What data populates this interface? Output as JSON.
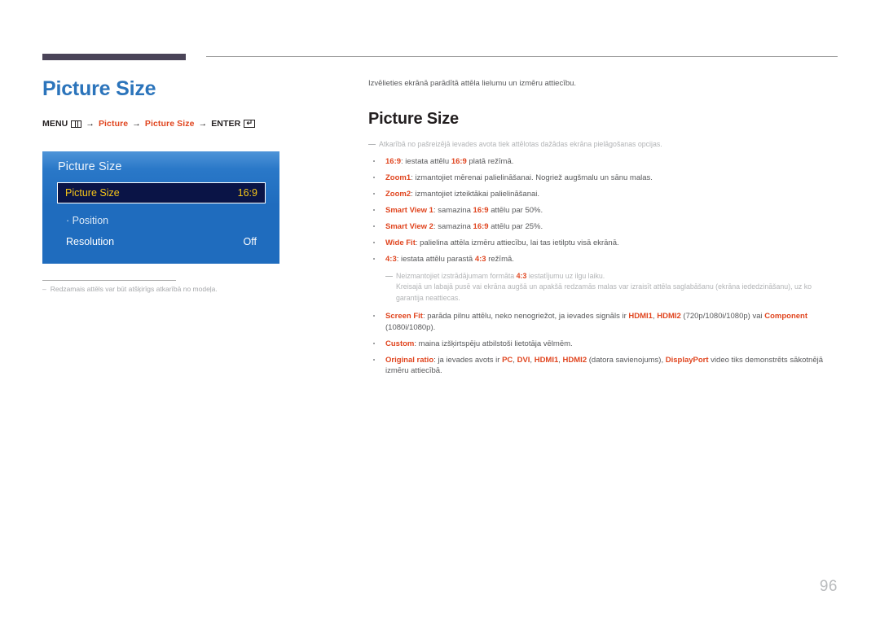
{
  "page": {
    "number": "96"
  },
  "left": {
    "title": "Picture Size",
    "breadcrumb": {
      "menu_label": "MENU",
      "menu_icon": "menu-grid-icon",
      "arrow": "→",
      "item1": "Picture",
      "item2": "Picture Size",
      "enter_label": "ENTER",
      "enter_icon": "enter-return-icon",
      "enter_glyph": "↵"
    },
    "osd": {
      "title": "Picture Size",
      "rows": [
        {
          "label": "Picture Size",
          "value": "16:9",
          "selected": true
        },
        {
          "label": "· Position",
          "value": "",
          "selected": false
        },
        {
          "label": "Resolution",
          "value": "Off",
          "selected": false
        }
      ]
    },
    "footnote": {
      "dash": "–",
      "text": "Redzamais attēls var būt atšķirīgs atkarībā no modeļa."
    }
  },
  "right": {
    "intro": "Izvēlieties ekrānā parādītā attēla lielumu un izmēru attiecību.",
    "title": "Picture Size",
    "note": "Atkarībā no pašreizējā ievades avota tiek attēlotas dažādas ekrāna pielāgošanas opcijas.",
    "bullets": [
      {
        "id": "ratio-16-9",
        "html": "<span class=\"kw\">16:9</span>: iestata attēlu <span class=\"kw\">16:9</span> platā režīmā."
      },
      {
        "id": "zoom1",
        "html": "<span class=\"kw\">Zoom1</span>: izmantojiet mērenai palielināšanai. Nogriež augšmalu un sānu malas."
      },
      {
        "id": "zoom2",
        "html": "<span class=\"kw\">Zoom2</span>: izmantojiet izteiktākai palielināšanai."
      },
      {
        "id": "smart-view-1",
        "html": "<span class=\"kw\">Smart View 1</span>: samazina <span class=\"kw\">16:9</span> attēlu par 50%."
      },
      {
        "id": "smart-view-2",
        "html": "<span class=\"kw\">Smart View 2</span>: samazina <span class=\"kw\">16:9</span> attēlu par 25%."
      },
      {
        "id": "wide-fit",
        "html": "<span class=\"kw\">Wide Fit</span>: palielina attēla izmēru attiecību, lai tas ietilptu visā ekrānā."
      },
      {
        "id": "ratio-4-3",
        "html": "<span class=\"kw\">4:3</span>: iestata attēlu parastā <span class=\"kw\">4:3</span> režīmā."
      }
    ],
    "subnote": {
      "line1_html": "Neizmantojiet izstrādājumam formāta <span class=\"kw-faint\">4:3</span> iestatījumu uz ilgu laiku.",
      "line2": "Kreisajā un labajā pusē vai ekrāna augšā un apakšā redzamās malas var izraisīt attēla saglabāšanu (ekrāna iededzināšanu), uz ko garantija neattiecas."
    },
    "bullets2": [
      {
        "id": "screen-fit",
        "html": "<span class=\"kw\">Screen Fit</span>: parāda pilnu attēlu, neko nenogriežot, ja ievades signāls ir <span class=\"kw\">HDMI1</span>, <span class=\"kw\">HDMI2</span> (720p/1080i/1080p) vai <span class=\"kw\">Component</span> (1080i/1080p)."
      },
      {
        "id": "custom",
        "html": "<span class=\"kw\">Custom</span>: maina izšķirtspēju atbilstoši lietotāja vēlmēm."
      },
      {
        "id": "original-ratio",
        "html": "<span class=\"kw\">Original ratio</span>: ja ievades avots ir <span class=\"kw\">PC</span>, <span class=\"kw\">DVI</span>, <span class=\"kw\">HDMI1</span>, <span class=\"kw\">HDMI2</span> (datora savienojums), <span class=\"kw\">DisplayPort</span> video tiks demonstrēts sākotnējā izmēru attiecībā."
      }
    ]
  },
  "colors": {
    "accent_blue": "#2b74bb",
    "accent_orange": "#e0451f",
    "osd_blue": "#1f6cbe",
    "osd_selected_bg": "#0a1446",
    "osd_selected_text": "#f5c518",
    "rule_purple": "#4a4458",
    "body_text": "#58595b",
    "muted_text": "#b2b4b6"
  }
}
